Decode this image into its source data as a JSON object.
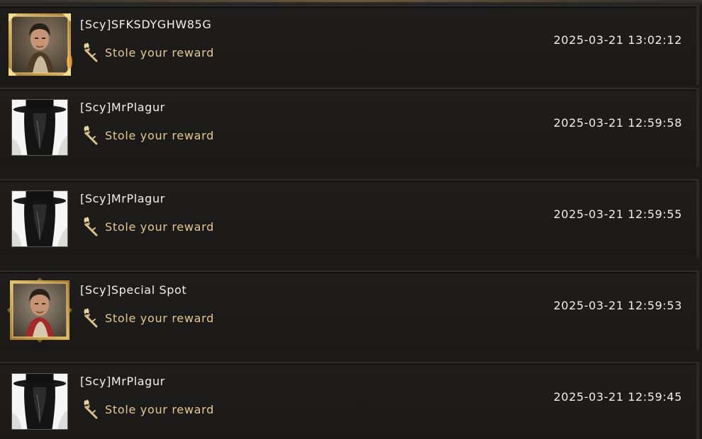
{
  "entries": [
    {
      "name": "[Scy]SFKSDYGHW85G",
      "action": "Stole your reward",
      "time": "2025-03-21 13:02:12",
      "avatar": "hero-portrait-icon"
    },
    {
      "name": "[Scy]MrPlagur",
      "action": "Stole your reward",
      "time": "2025-03-21 12:59:58",
      "avatar": "plague-doctor-icon"
    },
    {
      "name": "[Scy]MrPlagur",
      "action": "Stole your reward",
      "time": "2025-03-21 12:59:55",
      "avatar": "plague-doctor-icon"
    },
    {
      "name": "[Scy]Special Spot",
      "action": "Stole your reward",
      "time": "2025-03-21 12:59:53",
      "avatar": "hero-portrait-icon"
    },
    {
      "name": "[Scy]MrPlagur",
      "action": "Stole your reward",
      "time": "2025-03-21 12:59:45",
      "avatar": "plague-doctor-icon"
    }
  ],
  "colors": {
    "background": "#1c1b19",
    "name_text": "#f2f0ec",
    "action_text": "#e3c98f",
    "gold_frame": "#c9a24f"
  },
  "icons": {
    "action": "torch-icon"
  }
}
